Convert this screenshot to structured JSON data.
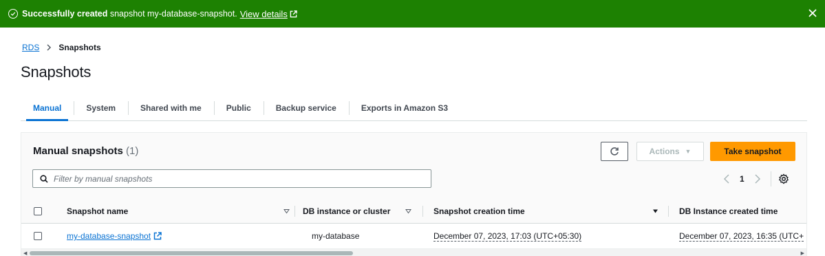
{
  "flash": {
    "bold_text": "Successfully created",
    "text": " snapshot my-database-snapshot.",
    "link": "View details"
  },
  "breadcrumb": {
    "root": "RDS",
    "current": "Snapshots"
  },
  "page_title": "Snapshots",
  "tabs": [
    {
      "label": "Manual"
    },
    {
      "label": "System"
    },
    {
      "label": "Shared with me"
    },
    {
      "label": "Public"
    },
    {
      "label": "Backup service"
    },
    {
      "label": "Exports in Amazon S3"
    }
  ],
  "panel": {
    "title": "Manual snapshots",
    "count": "(1)",
    "actions_label": "Actions",
    "take_snapshot_label": "Take snapshot",
    "filter_placeholder": "Filter by manual snapshots",
    "page_number": "1"
  },
  "table": {
    "columns": [
      "Snapshot name",
      "DB instance or cluster",
      "Snapshot creation time",
      "DB Instance created time"
    ],
    "rows": [
      {
        "snapshot_name": "my-database-snapshot",
        "db_instance": "my-database",
        "creation_time": "December 07, 2023, 17:03 (UTC+05:30)",
        "instance_created_time": "December 07, 2023, 16:35 (UTC+"
      }
    ]
  },
  "colors": {
    "success_green": "#1d8102",
    "link_blue": "#0972d3",
    "primary_orange": "#ff9900"
  },
  "icons": [
    "success-check-icon",
    "external-link-icon",
    "close-icon",
    "chevron-right-icon",
    "refresh-icon",
    "caret-down-icon",
    "search-icon",
    "chevron-left-icon",
    "gear-icon",
    "sort-caret-icon"
  ]
}
